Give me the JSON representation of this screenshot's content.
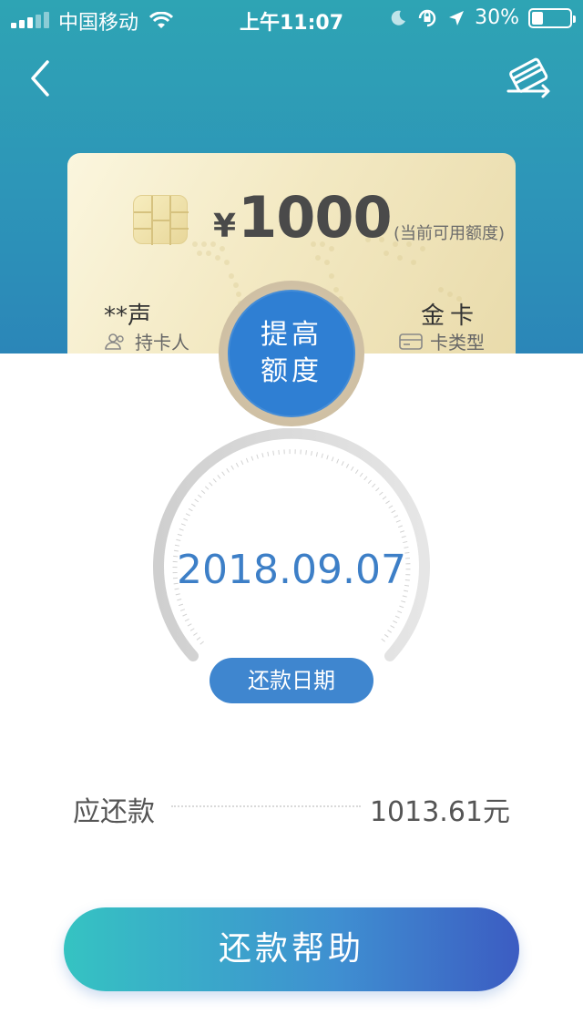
{
  "status_bar": {
    "carrier": "中国移动",
    "time": "上午11:07",
    "battery": "30%",
    "battery_level": 0.3
  },
  "nav": {
    "back_icon": "chevron-left-icon",
    "card_manage_icon": "card-swap-icon"
  },
  "card": {
    "currency": "¥",
    "amount": "1000",
    "amount_label": "(当前可用额度)",
    "holder_name": "**声",
    "holder_label": "持卡人",
    "card_type": "金卡",
    "card_type_label": "卡类型"
  },
  "raise_limit": {
    "label": "提高额度"
  },
  "repayment": {
    "due_date": "2018.09.07",
    "due_date_label": "还款日期",
    "amount_label": "应还款",
    "amount_value": "1013.61元"
  },
  "help_button": {
    "label": "还款帮助"
  },
  "colors": {
    "header_top": "#2ea4b4",
    "header_bottom": "#2b86b8",
    "accent_blue": "#2f7fd3",
    "date_text": "#3d7fc7",
    "button_gradient_start": "#35c3c2",
    "button_gradient_end": "#3c5cc2"
  }
}
